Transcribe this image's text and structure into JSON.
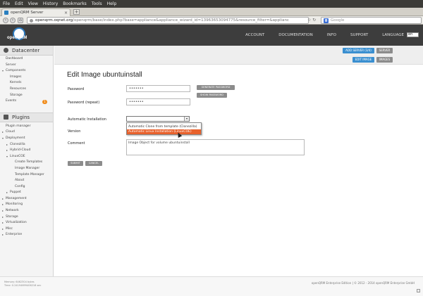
{
  "browser": {
    "menu": [
      "File",
      "Edit",
      "View",
      "History",
      "Bookmarks",
      "Tools",
      "Help"
    ],
    "tab_title": "openQRM Server",
    "new_tab": "+",
    "url_host": "openqrm.oqnet.org",
    "url_rest": "/openqrm/base/index.php?base=appliance&appliance_wizard_id=13963653094775&resource_filter=&applianc",
    "search_placeholder": "Google"
  },
  "header": {
    "logo_text": "openQRM",
    "nav": [
      "ACCOUNT",
      "DOCUMENTATION",
      "INFO",
      "SUPPORT"
    ],
    "language_label": "LANGUAGE",
    "language_value": "en"
  },
  "sidebar": {
    "datacenter_title": "Datacenter",
    "datacenter_items": [
      {
        "label": "Dashboard"
      },
      {
        "label": "Server"
      },
      {
        "label": "Components"
      },
      {
        "label": "Images"
      },
      {
        "label": "Kernels"
      },
      {
        "label": "Resources"
      },
      {
        "label": "Storage"
      },
      {
        "label": "Events",
        "badge": "1"
      }
    ],
    "plugins_title": "Plugins",
    "plugin_items": [
      {
        "label": "Plugin manager"
      },
      {
        "label": "Cloud"
      },
      {
        "label": "Deployment"
      },
      {
        "label": "Clonezilla"
      },
      {
        "label": "Hybrid-Cloud"
      },
      {
        "label": "LinuxCOE"
      },
      {
        "label": "Create Templates"
      },
      {
        "label": "Image Manager"
      },
      {
        "label": "Template Manager"
      },
      {
        "label": "About"
      },
      {
        "label": "Config"
      },
      {
        "label": "Puppet"
      },
      {
        "label": "Management"
      },
      {
        "label": "Monitoring"
      },
      {
        "label": "Network"
      },
      {
        "label": "Storage"
      },
      {
        "label": "Virtualization"
      },
      {
        "label": "Misc"
      },
      {
        "label": "Enterprise"
      }
    ]
  },
  "toolbar": {
    "add_server": "ADD SERVER (3/4)",
    "server": "SERVER",
    "edit_image": "EDIT IMAGE",
    "images": "IMAGES"
  },
  "form": {
    "title": "Edit Image ubuntuinstall",
    "password_label": "Password",
    "password_value": "•••••••",
    "password_repeat_label": "Password (repeat)",
    "password_repeat_value": "•••••••",
    "generate_password": "GENERATE PASSWORD",
    "show_password": "SHOW PASSWORD",
    "auto_install_label": "Automatic Installation",
    "auto_install_options": [
      "Automatic Clone from template (Clonezilla)",
      "Automatic Linux Installation (LinuxCOE)"
    ],
    "version_label": "Version",
    "comment_label": "Comment",
    "comment_value": "Image Object for volume ubuntuinstall",
    "submit": "SUBMIT",
    "cancel": "CANCEL"
  },
  "footer": {
    "left_line1": "Memory: 6462304 bytes",
    "left_line2": "Time: 0.24194699406218 sec",
    "right": "openQRM Enterprise Edition | © 2012 - 2014 openQRM Enterprise GmbH"
  },
  "colors": {
    "accent_blue": "#3a8fd0",
    "header_dark": "#3d3d3d",
    "selected_orange": "#e8612c",
    "badge_orange": "#f08c1c"
  }
}
